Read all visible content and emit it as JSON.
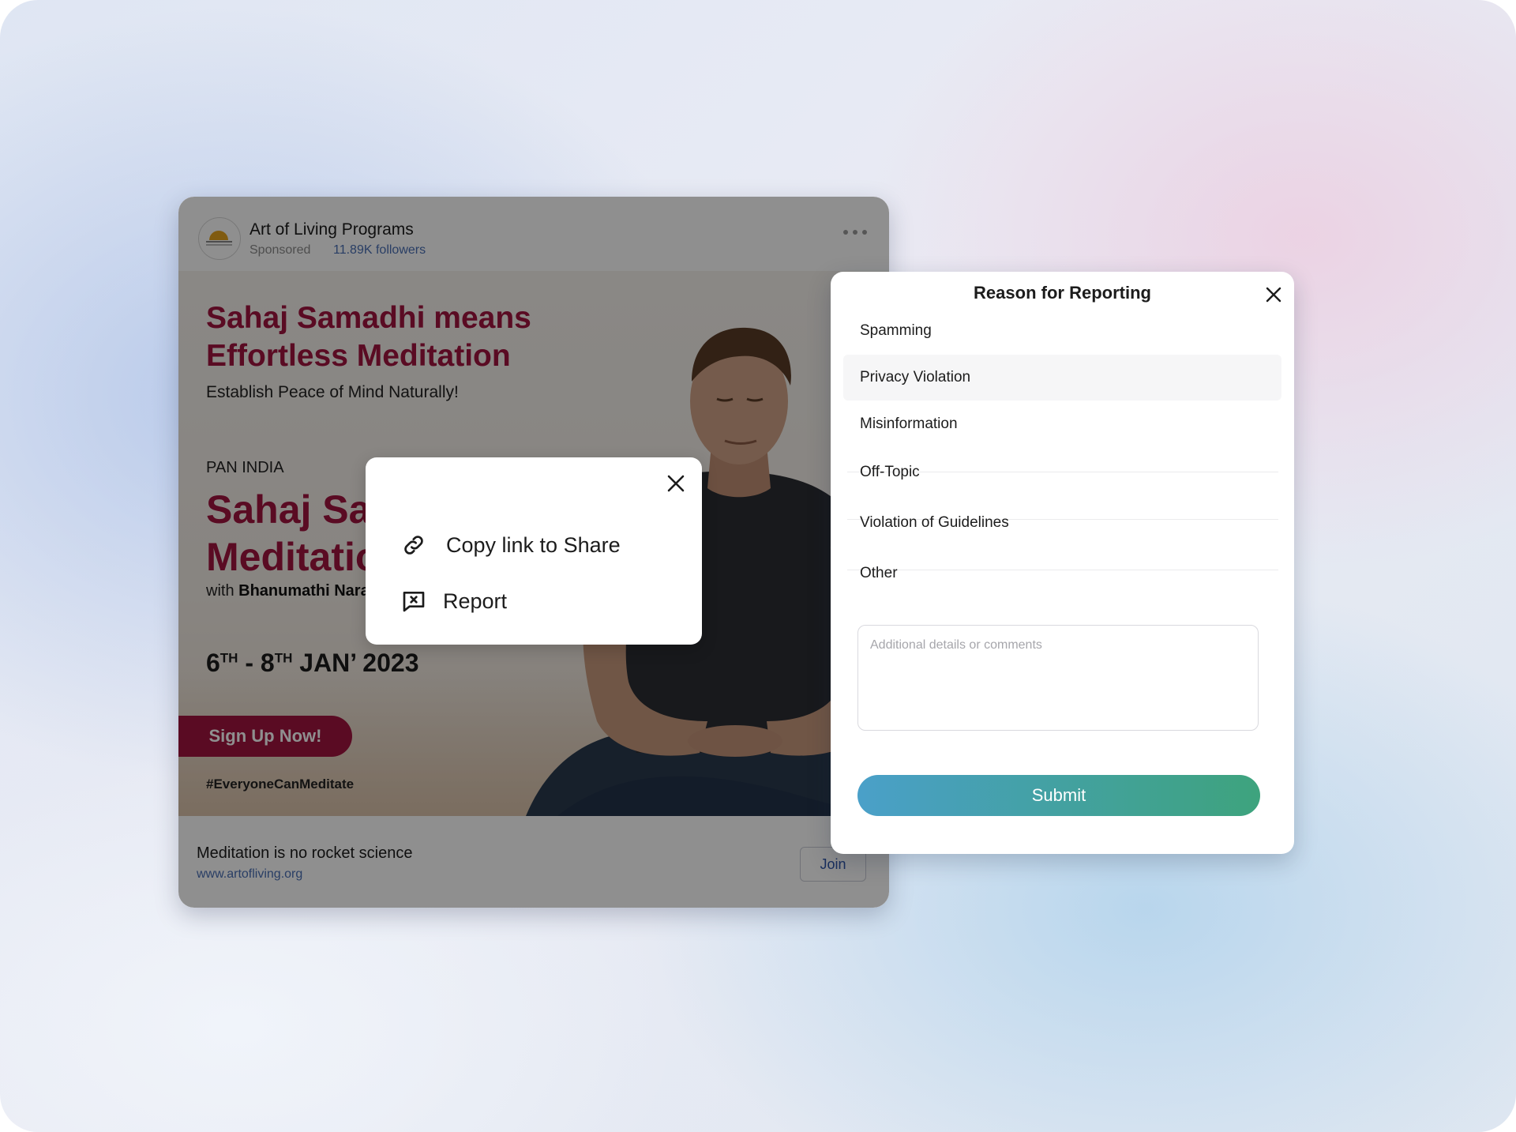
{
  "post": {
    "org_name": "Art of Living Programs",
    "sponsored": "Sponsored",
    "followers": "11.89K followers",
    "more_icon": "more-horizontal-icon",
    "banner": {
      "headline_line1": "Sahaj Samadhi means",
      "headline_line2": "Effortless Meditation",
      "subline": "Establish Peace of Mind Naturally!",
      "pan_india": "PAN INDIA",
      "title_line1": "Sahaj Samadhi",
      "title_line2": "Meditation",
      "with_prefix": "with ",
      "with_name": "Bhanumathi Narasimhan",
      "date_start": "6",
      "date_start_sup": "TH",
      "date_sep": " - ",
      "date_end": "8",
      "date_end_sup": "TH",
      "date_month": " JAN’ 2023",
      "signup": "Sign Up Now!",
      "hashtag": "#EveryoneCanMeditate"
    },
    "caption": "Meditation is no rocket science",
    "site": "www.artofliving.org",
    "join": "Join"
  },
  "share_menu": {
    "close_icon": "close-icon",
    "items": [
      {
        "label": "Copy link to Share",
        "icon": "link-icon"
      },
      {
        "label": "Report",
        "icon": "report-icon"
      }
    ]
  },
  "report": {
    "title": "Reason for Reporting",
    "close_icon": "close-icon",
    "reasons": [
      "Spamming",
      "Privacy Violation",
      "Misinformation",
      "Off-Topic",
      "Violation of Guidelines",
      "Other"
    ],
    "highlighted_reason": "Privacy Violation",
    "details_placeholder": "Additional details or comments",
    "details_value": "",
    "submit": "Submit",
    "submit_gradient": [
      "#4aa0c9",
      "#3ea37d"
    ]
  }
}
